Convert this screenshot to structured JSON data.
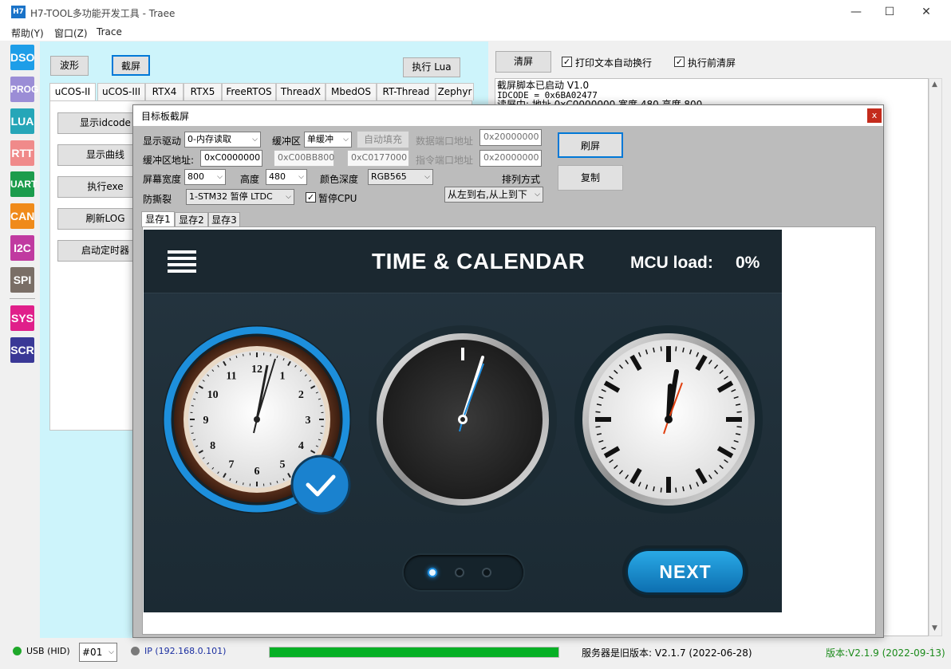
{
  "window": {
    "icon_text": "H7",
    "title": "H7-TOOL多功能开发工具 - Traee",
    "minimize": "—",
    "maximize": "☐",
    "close": "✕"
  },
  "menu": [
    "帮助(Y)",
    "窗口(Z)",
    "Trace"
  ],
  "sidebar": {
    "items": [
      {
        "label": "DSO",
        "color": "#1e9ee8"
      },
      {
        "label": "PROG",
        "color": "#9b8dd6"
      },
      {
        "label": "LUA",
        "color": "#26a6b8"
      },
      {
        "label": "RTT",
        "color": "#f08a8a"
      },
      {
        "label": "UART",
        "color": "#1c9c4c"
      },
      {
        "label": "CAN",
        "color": "#f08a1a"
      },
      {
        "label": "I2C",
        "color": "#c03aa0"
      },
      {
        "label": "SPI",
        "color": "#7a6e66"
      },
      {
        "label": "SYS",
        "color": "#e01f8a"
      },
      {
        "label": "SCR",
        "color": "#3a3896"
      }
    ]
  },
  "toolbar": {
    "wave": "波形",
    "screenshot": "截屏",
    "run_lua": "执行 Lua"
  },
  "rtos_tabs": [
    "uCOS-II",
    "uCOS-III",
    "RTX4",
    "RTX5",
    "FreeRTOS",
    "ThreadX",
    "MbedOS",
    "RT-Thread",
    "Zephyr"
  ],
  "left_buttons": [
    "显示idcode",
    "显示曲线",
    "执行exe",
    "刷新LOG",
    "启动定时器"
  ],
  "right": {
    "clear": "清屏",
    "autowrap": "打印文本自动换行",
    "clear_before": "执行前清屏",
    "log": [
      "截屏脚本已启动    V1.0",
      "IDCODE = 0x6BA02477",
      "读屏中: 地址 0xC0000000 宽度 480 高度 800"
    ]
  },
  "status": {
    "usb": "USB (HID)",
    "port": "#01",
    "ip": "IP (192.168.0.101)",
    "progress": 1.0,
    "server": "服务器是旧版本: V2.1.7 (2022-06-28)",
    "version": "版本:V2.1.9 (2022-09-13)"
  },
  "dialog": {
    "title": "目标板截屏",
    "close": "x",
    "driver_label": "显示驱动",
    "driver_value": "0-内存读取",
    "buffer_label": "缓冲区",
    "buffer_value": "单缓冲",
    "autofill": "自动填充",
    "data_port_label": "数据端口地址",
    "data_port_value": "0x20000000",
    "buf_addr_label": "缓冲区地址:",
    "buf_addr_value": "0xC0000000",
    "buf_addr2": "0xC00BB800",
    "buf_addr3": "0xC0177000",
    "cmd_port_label": "指令端口地址",
    "cmd_port_value": "0x20000000",
    "width_label": "屏幕宽度",
    "width_value": "800",
    "height_label": "高度",
    "height_value": "480",
    "depth_label": "颜色深度",
    "depth_value": "RGB565",
    "order_label": "排列方式",
    "order_value": "从左到右,从上到下",
    "tearing_label": "防撕裂",
    "tearing_value": "1-STM32 暂停 LTDC",
    "pause_cpu": "暂停CPU",
    "refresh": "刷屏",
    "copy": "复制",
    "tabs": [
      "显存1",
      "显存2",
      "显存3"
    ]
  },
  "lcd": {
    "title": "TIME & CALENDAR",
    "mcu_label": "MCU load:",
    "mcu_value": "0%",
    "next": "NEXT",
    "clock_numbers": [
      "12",
      "1",
      "2",
      "3",
      "4",
      "5",
      "6",
      "7",
      "8",
      "9",
      "10",
      "11"
    ]
  }
}
